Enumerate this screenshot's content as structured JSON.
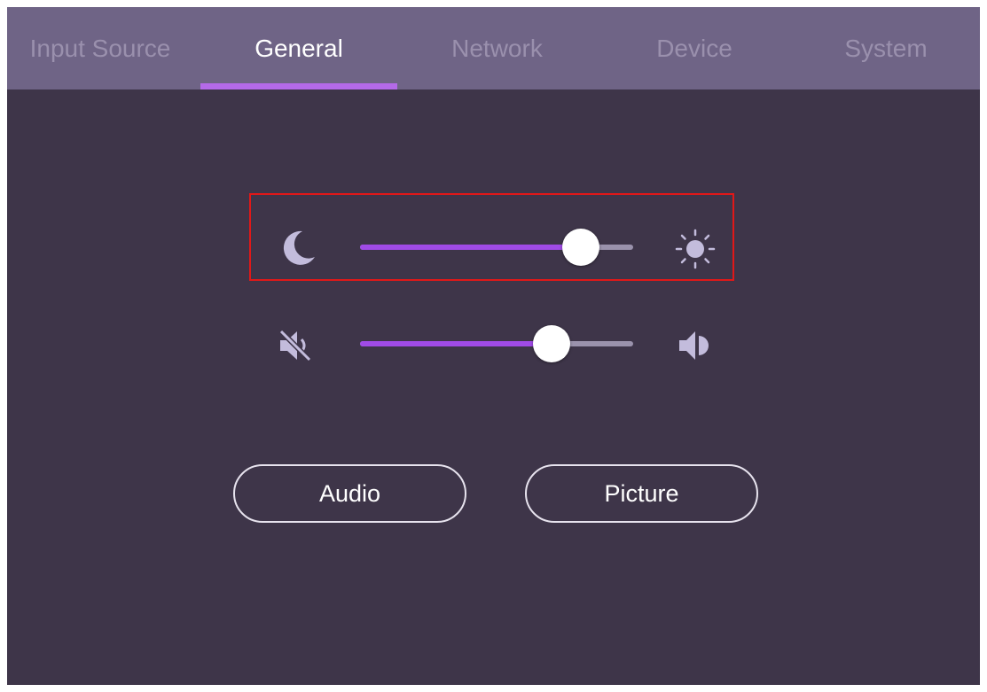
{
  "tabs": [
    {
      "label": "Input Source",
      "active": false
    },
    {
      "label": "General",
      "active": true
    },
    {
      "label": "Network",
      "active": false
    },
    {
      "label": "Device",
      "active": false
    },
    {
      "label": "System",
      "active": false
    }
  ],
  "brightness": {
    "level_fraction": 0.81,
    "min_icon": "moon-icon",
    "max_icon": "sun-icon"
  },
  "volume": {
    "level_fraction": 0.7,
    "min_icon": "volume-mute-icon",
    "max_icon": "volume-up-icon"
  },
  "buttons": {
    "audio_label": "Audio",
    "picture_label": "Picture"
  },
  "colors": {
    "background": "#3e3549",
    "tab_bar": "#6f6486",
    "accent": "#a04be6",
    "tab_indicator": "#b46ae8",
    "highlight_border": "#e01818",
    "icon": "#c3bcdc"
  }
}
